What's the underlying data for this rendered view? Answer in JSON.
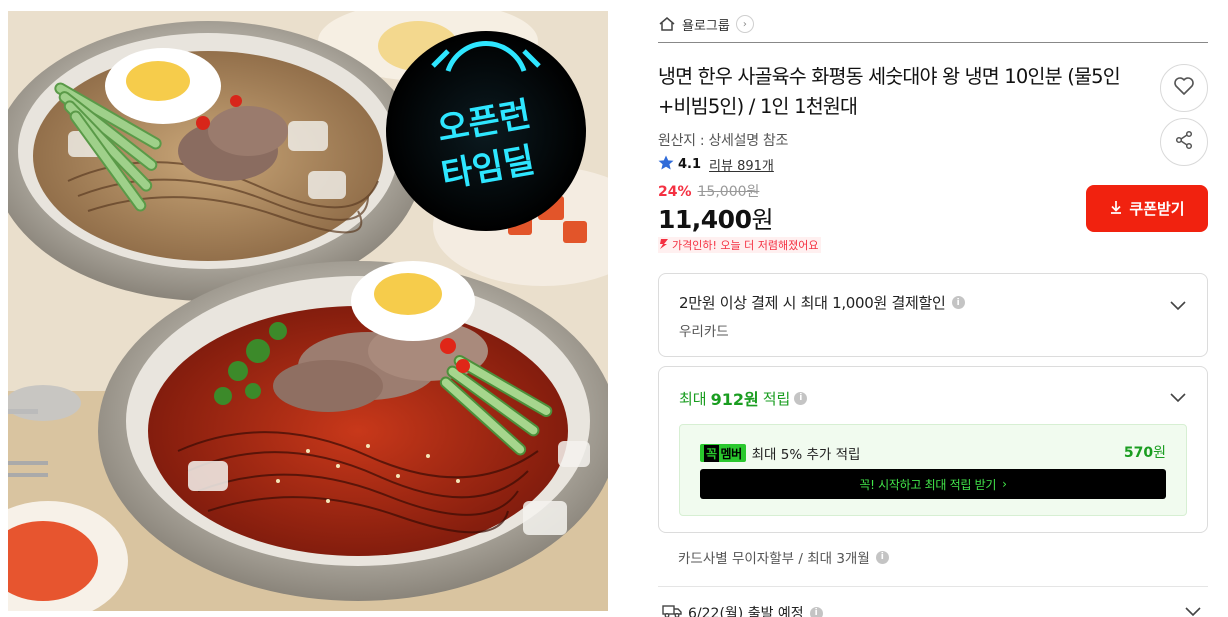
{
  "image": {
    "alt_icon": "food-photo",
    "badge": {
      "line1": "오픈런",
      "line2": "타임딜",
      "color": "#2ee6ff"
    }
  },
  "store": {
    "name": "욜로그룹"
  },
  "product": {
    "title": "냉면 한우 사골육수 화평동 세숫대야 왕 냉면 10인분 (물5인+비빔5인) / 1인 1천원대",
    "origin": "원산지 : 상세설명 참조",
    "rating": "4.1",
    "review_label": "리뷰 891개"
  },
  "price": {
    "discount": "24%",
    "original": "15,000원",
    "sale_number": "11,400",
    "sale_unit": "원",
    "drop_notice": "가격인하! 오늘 더 저렴해졌어요"
  },
  "coupon": {
    "label": "쿠폰받기",
    "color": "#f1220f"
  },
  "card_discount": {
    "line1": "2만원 이상 결제 시 최대 1,000원 결제할인",
    "line2": "우리카드"
  },
  "points": {
    "prefix": "최대",
    "amount": "912원",
    "suffix": "적립",
    "member_logo_k": "꼭",
    "member_logo_text": "멤버",
    "member_text": "최대 5% 추가 적립",
    "member_amount": "570",
    "member_unit": "원",
    "cta": "꼭! 시작하고 최대 적립 받기",
    "accent": "#1a9d20"
  },
  "installment": "카드사별 무이자할부 / 최대 3개월",
  "delivery": "6/22(월) 출발 예정",
  "icons": {
    "home": "home-icon",
    "heart": "heart-icon",
    "share": "share-icon",
    "star": "star-icon",
    "download": "download-icon",
    "chevron": "chevron-down-icon",
    "truck": "truck-icon",
    "info": "info-icon"
  }
}
